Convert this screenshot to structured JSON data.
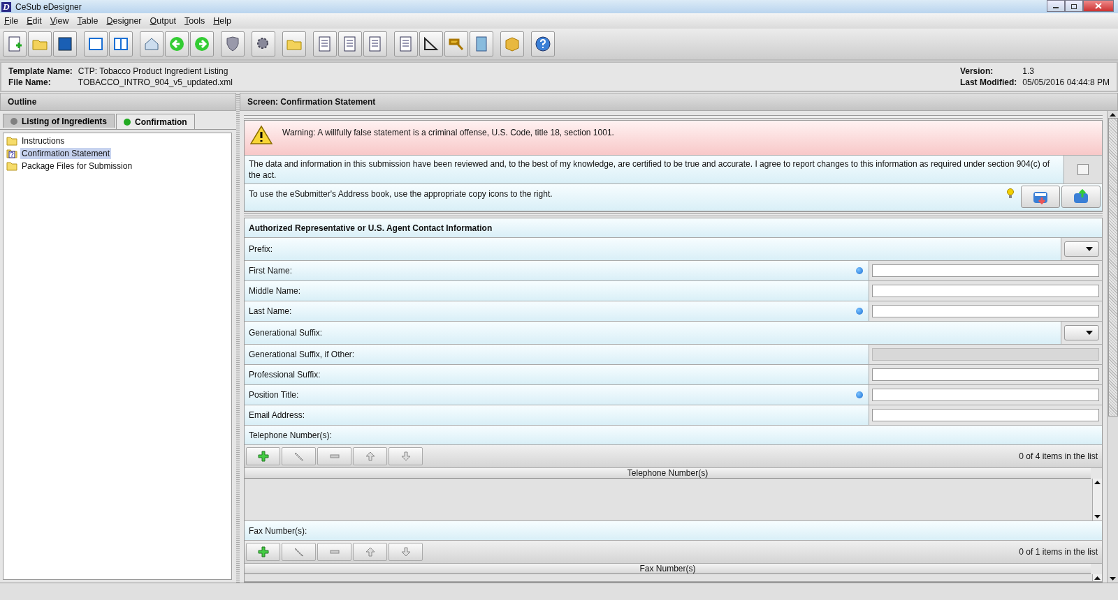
{
  "window": {
    "title": "CeSub eDesigner",
    "app_letter": "D"
  },
  "menu": [
    {
      "label": "File"
    },
    {
      "label": "Edit"
    },
    {
      "label": "View"
    },
    {
      "label": "Table"
    },
    {
      "label": "Designer"
    },
    {
      "label": "Output"
    },
    {
      "label": "Tools"
    },
    {
      "label": "Help"
    }
  ],
  "info": {
    "left": [
      {
        "label": "Template Name:",
        "value": "CTP: Tobacco Product Ingredient Listing"
      },
      {
        "label": "File Name:",
        "value": "TOBACCO_INTRO_904_v5_updated.xml"
      }
    ],
    "right": [
      {
        "label": "Version:",
        "value": "1.3"
      },
      {
        "label": "Last Modified:",
        "value": "05/05/2016 04:44:8 PM"
      }
    ]
  },
  "outline": {
    "title": "Outline",
    "tabs": [
      {
        "label": "Listing of Ingredients",
        "selected": false,
        "color": "#808080"
      },
      {
        "label": "Confirmation",
        "selected": true,
        "color": "#22aa22"
      }
    ],
    "items": [
      {
        "label": "Instructions",
        "kind": "folder",
        "selected": false
      },
      {
        "label": "Confirmation Statement",
        "kind": "question",
        "selected": true
      },
      {
        "label": "Package Files for Submission",
        "kind": "folder",
        "selected": false
      }
    ]
  },
  "screen": {
    "title": "Screen: Confirmation Statement",
    "warning": "Warning:  A willfully false statement is a criminal offense, U.S. Code, title 18, section 1001.",
    "statement": {
      "text": "The data and information in this submission have been reviewed and, to the best of my knowledge, are certified to be true and accurate. I agree to report changes to this information as required under section 904(c) of the act.",
      "checked": false
    },
    "address_hint": "To use the eSubmitter's Address book, use the appropriate copy icons to the right.",
    "section_title": "Authorized Representative or U.S. Agent Contact Information",
    "fields": [
      {
        "label": "Prefix:",
        "kind": "dropdown",
        "required": false,
        "disabled": false
      },
      {
        "label": "First Name:",
        "kind": "text",
        "required": true,
        "disabled": false
      },
      {
        "label": "Middle Name:",
        "kind": "text",
        "required": false,
        "disabled": false
      },
      {
        "label": "Last Name:",
        "kind": "text",
        "required": true,
        "disabled": false
      },
      {
        "label": "Generational Suffix:",
        "kind": "dropdown",
        "required": false,
        "disabled": false
      },
      {
        "label": "Generational Suffix, if Other:",
        "kind": "text",
        "required": false,
        "disabled": true
      },
      {
        "label": "Professional Suffix:",
        "kind": "text",
        "required": false,
        "disabled": false
      },
      {
        "label": "Position Title:",
        "kind": "text",
        "required": true,
        "disabled": false
      },
      {
        "label": "Email Address:",
        "kind": "text",
        "required": false,
        "disabled": false
      }
    ],
    "lists": [
      {
        "label": "Telephone Number(s):",
        "count": "0 of 4 items in the list",
        "column": "Telephone Number(s)"
      },
      {
        "label": "Fax Number(s):",
        "count": "0 of 1 items in the list",
        "column": "Fax Number(s)"
      }
    ]
  }
}
